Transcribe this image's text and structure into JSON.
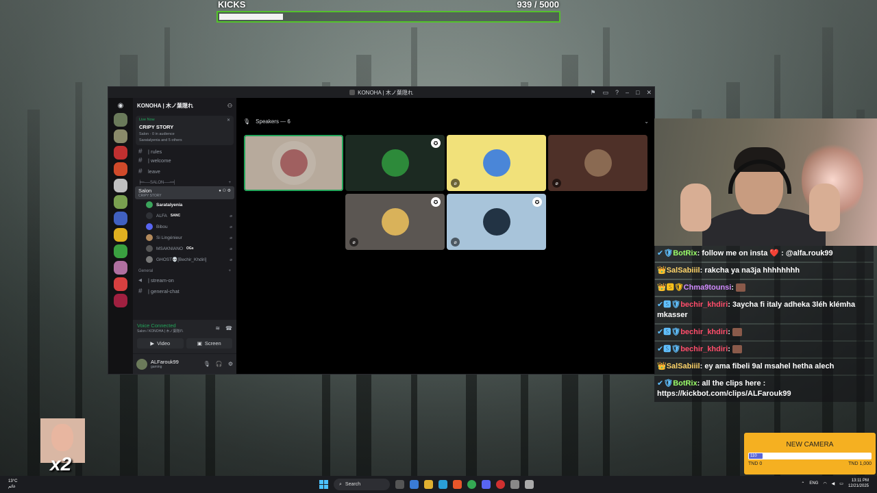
{
  "kicks_goal": {
    "label": "KICKS",
    "current": 939,
    "target": 5000,
    "count_text": "939 / 5000"
  },
  "discord": {
    "window_title": "KONOHA | 木ノ葉隠れ",
    "server_name": "KONOHA | 木ノ葉隠れ",
    "live": {
      "status": "Live Now",
      "title": "CRIPY STORY",
      "channel": "Salon",
      "audience": "0 in audience",
      "participants": "Saratalyenia and 5 others"
    },
    "channels_top": [
      "| rules",
      "| welcome",
      "leave"
    ],
    "category_salon": "╞═──SALON──═╡",
    "voice_channel": {
      "name": "Salon",
      "topic": "CRIPY STORY"
    },
    "members": [
      {
        "name": "Saratalyenia",
        "tag": "",
        "color": "#3ba55c"
      },
      {
        "name": "ALFA",
        "tag": "SANC",
        "color": "#2f3136"
      },
      {
        "name": "Bibou",
        "tag": "",
        "color": "#5865f2"
      },
      {
        "name": "Si Lingénieur",
        "tag": "",
        "color": "#b38a5c"
      },
      {
        "name": "MSAKNIANO",
        "tag": "OGs",
        "color": "#555"
      },
      {
        "name": "GHOST💀[Bechir_Khdiri]",
        "tag": "",
        "color": "#777"
      }
    ],
    "category_general": "General",
    "channels_general": [
      "| stream-on",
      "| general-chat"
    ],
    "voice_panel": {
      "status": "Voice Connected",
      "path": "Salon / KONOHA | 木ノ葉隠れ",
      "video": "Video",
      "screen": "Screen"
    },
    "user": {
      "name": "ALFarouk99",
      "status": "gaming"
    },
    "stage": {
      "speakers_label": "Speakers — 6"
    },
    "tiles": [
      {
        "bg": "#b7aa9c",
        "pfp": "#a06060",
        "muted": false,
        "hat": false,
        "speaking": true
      },
      {
        "bg": "#1c2a22",
        "pfp": "#2d8a3a",
        "muted": false,
        "hat": true,
        "speaking": false
      },
      {
        "bg": "#f1e17a",
        "pfp": "#4a86d8",
        "muted": true,
        "hat": false,
        "speaking": false
      },
      {
        "bg": "#4e3028",
        "pfp": "#8a6a52",
        "muted": true,
        "hat": false,
        "speaking": false
      },
      {
        "bg": "#5b5652",
        "pfp": "#d9b25a",
        "muted": true,
        "hat": true,
        "speaking": false
      },
      {
        "bg": "#a8c4da",
        "pfp": "#223344",
        "muted": true,
        "hat": true,
        "speaking": false
      }
    ],
    "server_icons": [
      "#6a7a5a",
      "#8a8a6a",
      "#c03030",
      "#d04a2a",
      "#c0c0c0",
      "#7aa050",
      "#4060c0",
      "#e0b020",
      "#3aa040",
      "#b070a0",
      "#d84040",
      "#a02040"
    ]
  },
  "chat": [
    {
      "badges": "✔🛡",
      "user": "BotRix",
      "user_color": "#9bff6a",
      "text": "follow me on insta ❤️ : @alfa.rouk99"
    },
    {
      "badges": "👑",
      "user": "SalSabiiil",
      "user_color": "#ffd56a",
      "text": "rakcha ya na3ja hhhhhhhh"
    },
    {
      "badges": "👑🆂🛡",
      "user": "Chma9tounsi",
      "user_color": "#d28bff",
      "text": ""
    },
    {
      "badges": "✔🆂🛡",
      "user": "bechir_khdiri",
      "user_color": "#ff4d6a",
      "text": "3aycha fi italy adheka 3léh klémha mkasser"
    },
    {
      "badges": "✔🆂🛡",
      "user": "bechir_khdiri",
      "user_color": "#ff4d6a",
      "text": ""
    },
    {
      "badges": "✔🆂🛡",
      "user": "bechir_khdiri",
      "user_color": "#ff4d6a",
      "text": ""
    },
    {
      "badges": "👑",
      "user": "SalSabiiil",
      "user_color": "#ffd56a",
      "text": "ey ama fibeli 9al msahel hetha alech"
    },
    {
      "badges": "✔🛡",
      "user": "BotRix",
      "user_color": "#9bff6a",
      "text": "all the clips here : https://kickbot.com/clips/ALFarouk99"
    }
  ],
  "camera_goal": {
    "title": "NEW CAMERA",
    "current": "110",
    "start": "TND 0",
    "end": "TND 1,000",
    "progress": 0.11
  },
  "combo": {
    "text": "x2"
  },
  "taskbar": {
    "weather_temp": "13°C",
    "weather_desc": "غائم",
    "search_placeholder": "Search",
    "lang": "ENG",
    "time": "13:11 PM",
    "date": "12/21/2025"
  }
}
